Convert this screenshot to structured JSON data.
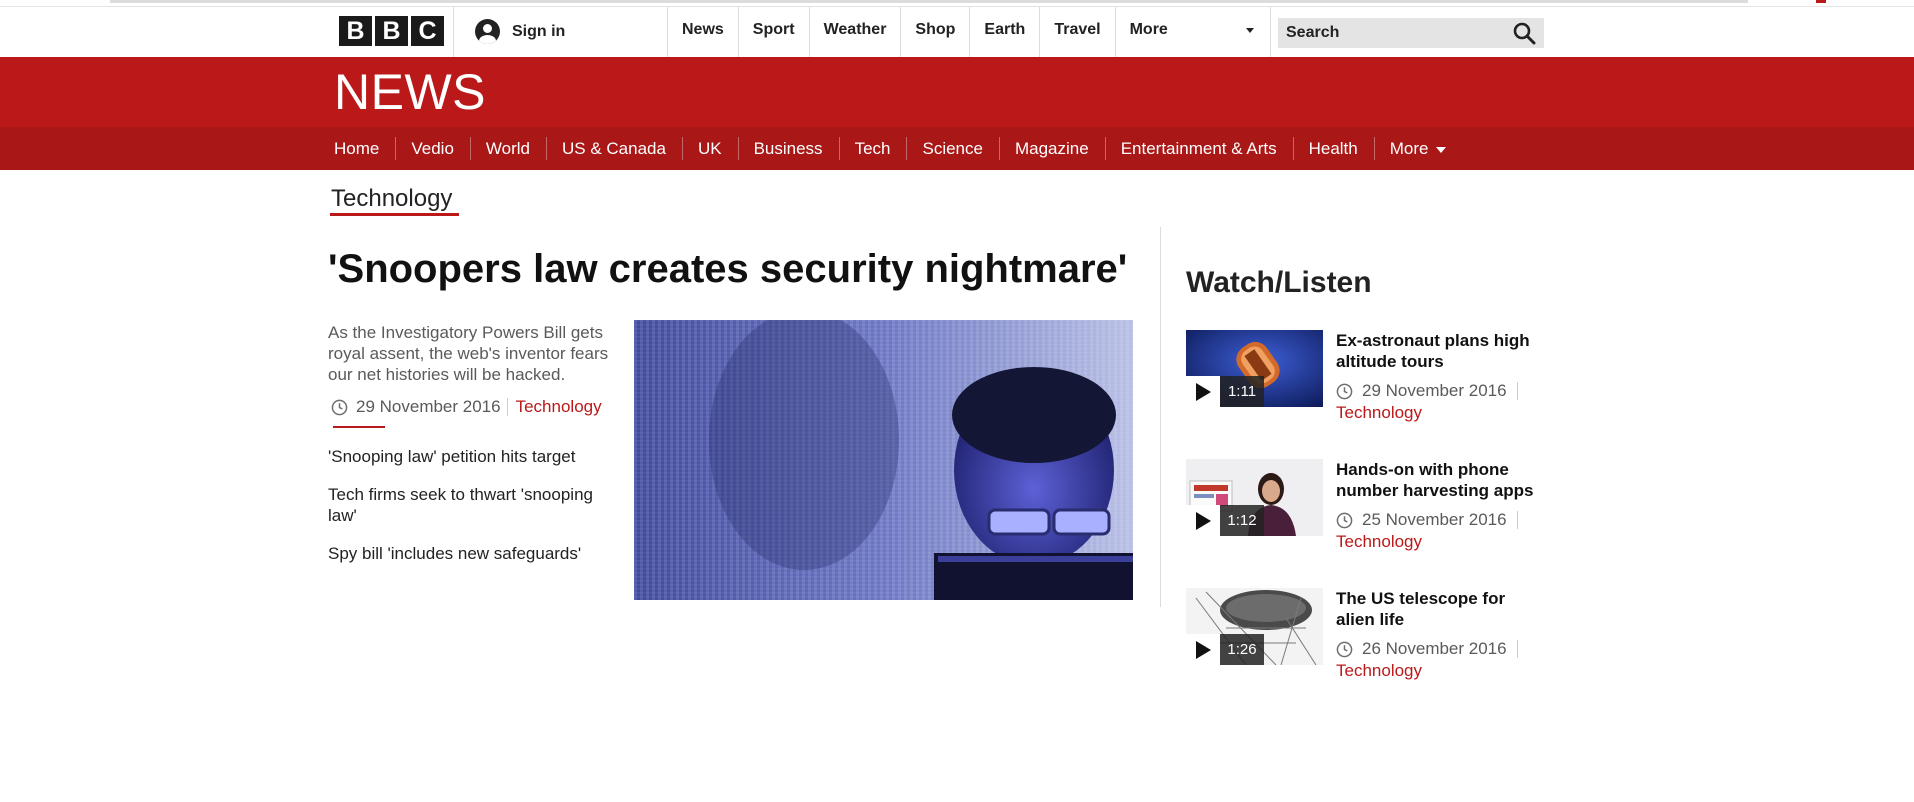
{
  "bbc": {
    "logo_letters": [
      "B",
      "B",
      "C"
    ],
    "signin_label": "Sign in",
    "nav": [
      "News",
      "Sport",
      "Weather",
      "Shop",
      "Earth",
      "Travel",
      "More"
    ],
    "search_placeholder": "Search"
  },
  "news": {
    "brand": "NEWS",
    "nav": [
      "Home",
      "Vedio",
      "World",
      "US & Canada",
      "UK",
      "Business",
      "Tech",
      "Science",
      "Magazine",
      "Entertainment & Arts",
      "Health",
      "More"
    ]
  },
  "section": {
    "title": "Technology"
  },
  "article": {
    "headline": "'Snoopers law creates security nightmare'",
    "summary": "As the Investigatory Powers Bill gets royal assent, the web's inventor fears our net histories will be hacked.",
    "date": "29 November 2016",
    "category": "Technology",
    "related": [
      "'Snooping law' petition hits target",
      "Tech firms seek to thwart 'snooping law'",
      "Spy bill 'includes new safeguards'"
    ]
  },
  "watch_listen": {
    "title": "Watch/Listen",
    "items": [
      {
        "headline": "Ex-astronaut plans high altitude tours",
        "duration": "1:11",
        "date": "29 November 2016",
        "category": "Technology"
      },
      {
        "headline": "Hands-on with phone number harvesting apps",
        "duration": "1:12",
        "date": "25 November 2016",
        "category": "Technology"
      },
      {
        "headline": "The US telescope for alien life",
        "duration": "1:26",
        "date": "26 November 2016",
        "category": "Technology"
      }
    ]
  },
  "colors": {
    "brand_red": "#bb1919",
    "nav_red": "#a91717",
    "text": "#222222",
    "muted": "#5a5a5a"
  }
}
